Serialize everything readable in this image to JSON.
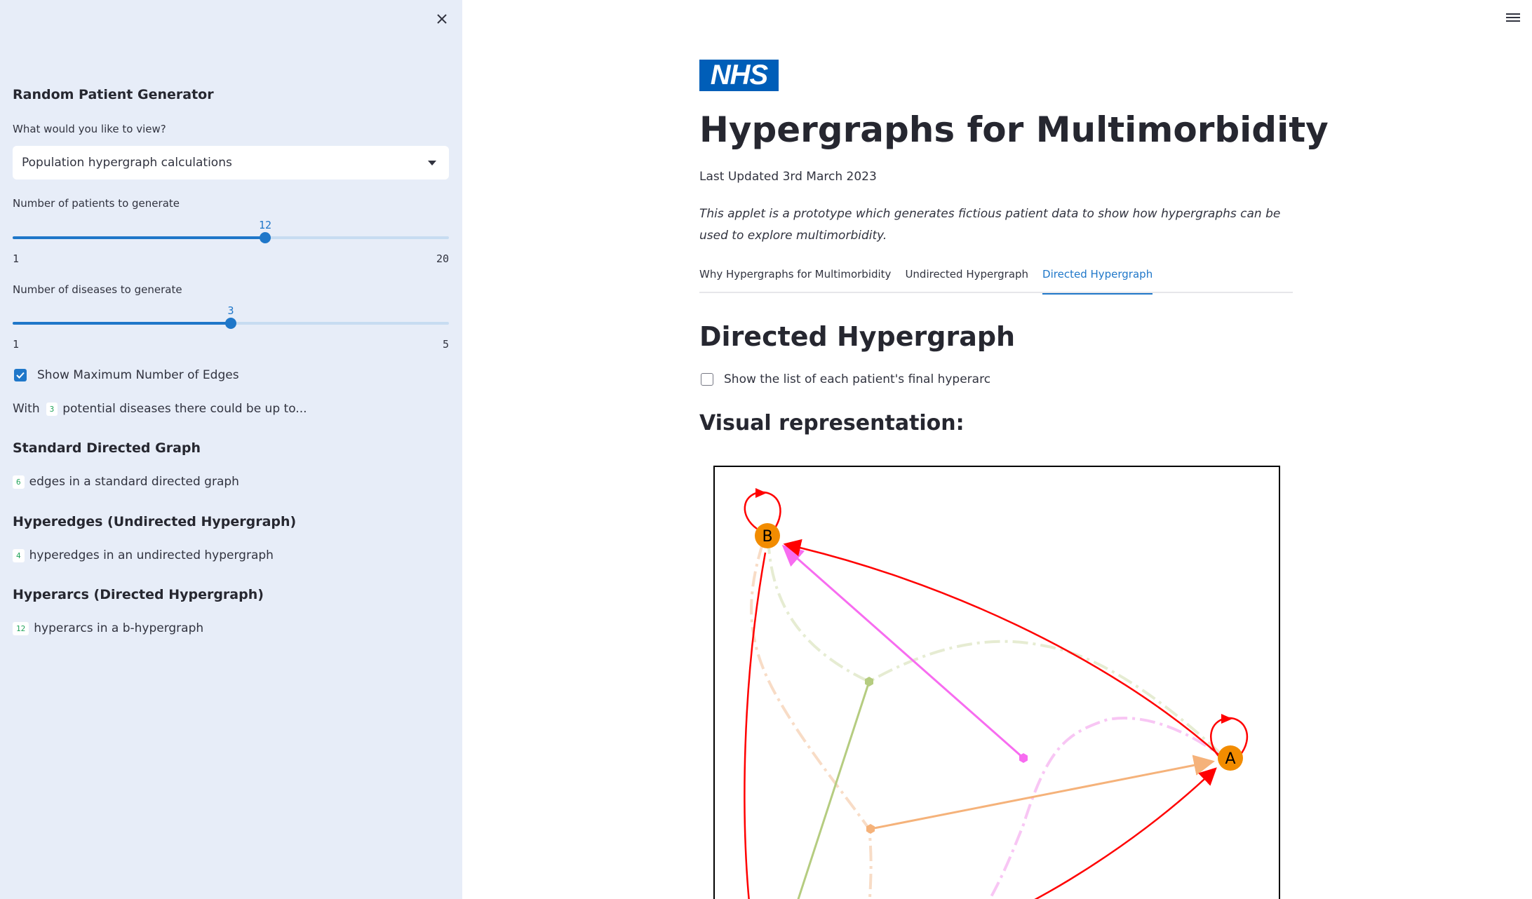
{
  "sidebar": {
    "title": "Random Patient Generator",
    "view_label": "What would you like to view?",
    "view_selected": "Population hypergraph calculations",
    "patients_label": "Number of patients to generate",
    "patients": {
      "value": 12,
      "min": 1,
      "max": 20
    },
    "diseases_label": "Number of diseases to generate",
    "diseases": {
      "value": 3,
      "min": 1,
      "max": 5
    },
    "show_max_edges_label": "Show Maximum Number of Edges",
    "show_max_edges_checked": true,
    "with_prefix": "With",
    "with_value": "3",
    "with_suffix": "potential diseases there could be up to...",
    "standard_heading": "Standard Directed Graph",
    "standard_count": "6",
    "standard_text": "edges in a standard directed graph",
    "hyperedges_heading": "Hyperedges (Undirected Hypergraph)",
    "hyperedges_count": "4",
    "hyperedges_text": "hyperedges in an undirected hypergraph",
    "hyperarcs_heading": "Hyperarcs (Directed Hypergraph)",
    "hyperarcs_count": "12",
    "hyperarcs_text": "hyperarcs in a b-hypergraph"
  },
  "main": {
    "logo_text": "NHS",
    "title": "Hypergraphs for Multimorbidity",
    "last_updated": "Last Updated 3rd March 2023",
    "intro": "This applet is a prototype which generates fictious patient data to show how hypergraphs can be used to explore multimorbidity.",
    "tabs": [
      {
        "label": "Why Hypergraphs for Multimorbidity",
        "active": false
      },
      {
        "label": "Undirected Hypergraph",
        "active": false
      },
      {
        "label": "Directed Hypergraph",
        "active": true
      }
    ],
    "section_title": "Directed Hypergraph",
    "show_list_label": "Show the list of each patient's final hyperarc",
    "show_list_checked": false,
    "visual_title": "Visual representation:",
    "graph": {
      "node_a_label": "A",
      "node_b_label": "B",
      "colors": {
        "node_fill": "#f28c00",
        "red_arc": "#ff0000",
        "magenta_arc": "#f76cf0",
        "orange_arc": "#f5b27a",
        "green_arc": "#b5cc80",
        "green_dash": "#e6ecd2",
        "pink_dash": "#f8c6f4",
        "peach_dash": "#f8dcc6"
      }
    }
  }
}
